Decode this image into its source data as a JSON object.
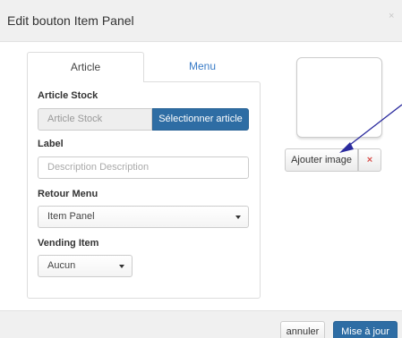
{
  "modal": {
    "title": "Edit bouton Item Panel",
    "close_label": "×"
  },
  "tabs": [
    {
      "label": "Article",
      "active": true
    },
    {
      "label": "Menu",
      "active": false
    }
  ],
  "form": {
    "article_stock": {
      "label": "Article Stock",
      "placeholder": "Article Stock",
      "button_label": "Sélectionner article"
    },
    "label_field": {
      "label": "Label",
      "placeholder": "Description Description"
    },
    "retour_menu": {
      "label": "Retour Menu",
      "selected": "Item Panel"
    },
    "vending_item": {
      "label": "Vending Item",
      "selected": "Aucun"
    }
  },
  "image_panel": {
    "add_image_label": "Ajouter image",
    "remove_label": "×"
  },
  "footer": {
    "cancel_label": "annuler",
    "update_label": "Mise à jour"
  },
  "colors": {
    "primary": "#2e6da4",
    "link": "#3a7cc7",
    "danger": "#d9534f",
    "annotation_arrow": "#2b2b9e"
  }
}
